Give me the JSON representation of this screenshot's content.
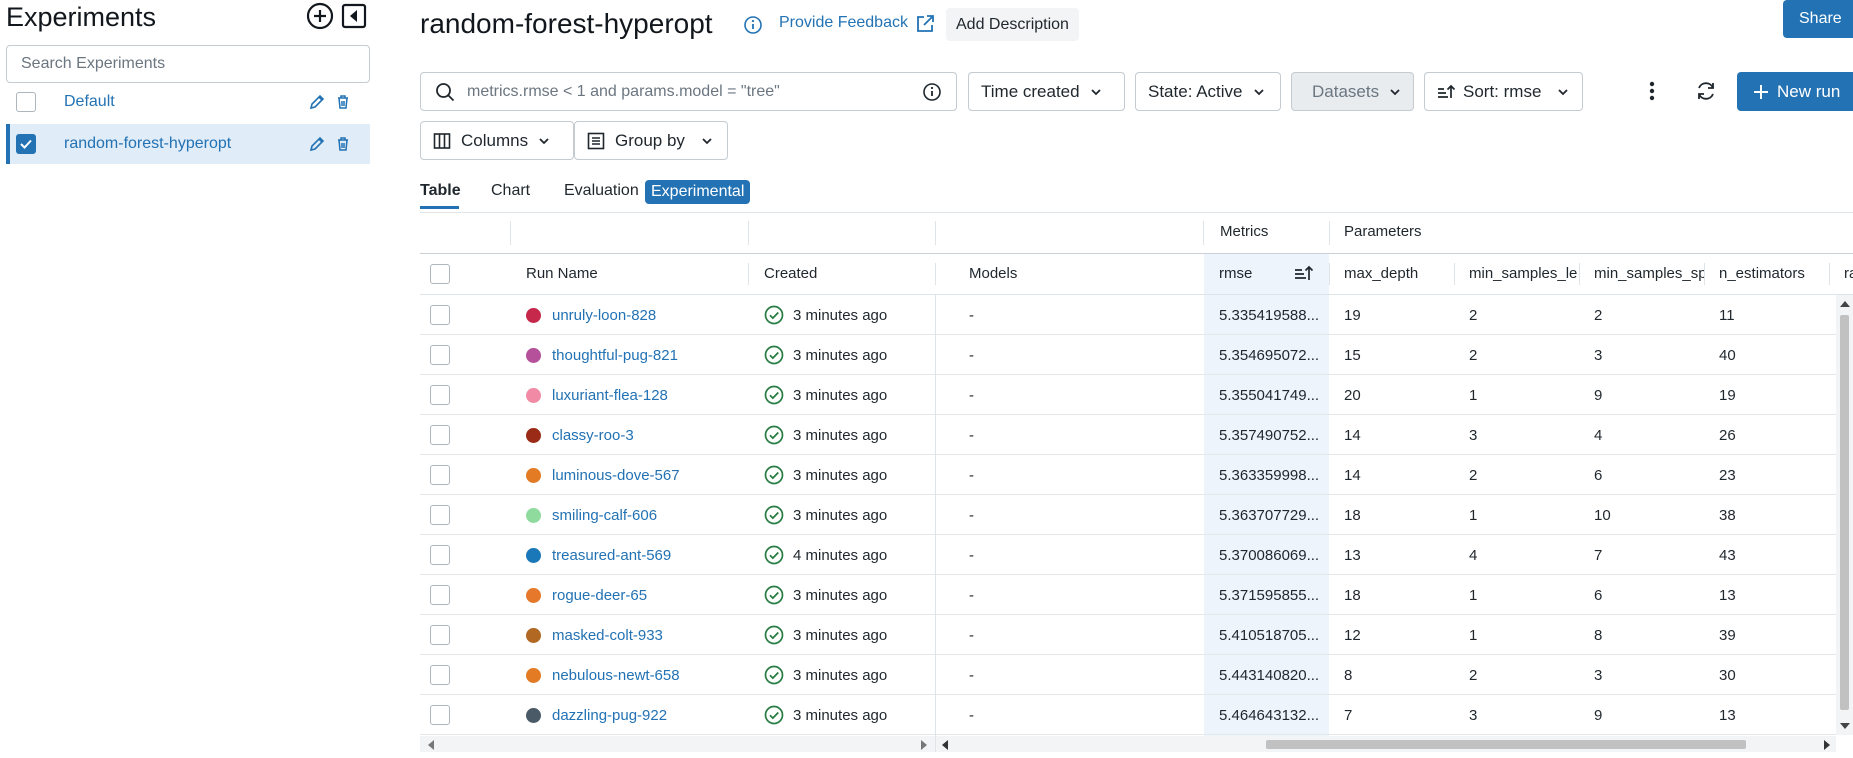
{
  "sidebar": {
    "title": "Experiments",
    "search_placeholder": "Search Experiments",
    "experiments": [
      {
        "name": "Default",
        "checked": false
      },
      {
        "name": "random-forest-hyperopt",
        "checked": true
      }
    ]
  },
  "header": {
    "title": "random-forest-hyperopt",
    "feedback": "Provide Feedback",
    "add_description": "Add Description",
    "share": "Share"
  },
  "toolbar": {
    "search_placeholder": "metrics.rmse < 1 and params.model = \"tree\"",
    "time_created": "Time created",
    "state": "State: Active",
    "datasets": "Datasets",
    "sort": "Sort: rmse",
    "new_run": "New run",
    "columns": "Columns",
    "group_by": "Group by"
  },
  "tabs": {
    "table": "Table",
    "chart": "Chart",
    "evaluation": "Evaluation",
    "experimental": "Experimental"
  },
  "table": {
    "groups": {
      "metrics": "Metrics",
      "parameters": "Parameters"
    },
    "columns": {
      "run_name": "Run Name",
      "created": "Created",
      "models": "Models",
      "rmse": "rmse",
      "max_depth": "max_depth",
      "min_samples_leaf": "min_samples_lea",
      "min_samples_split": "min_samples_sp",
      "n_estimators": "n_estimators",
      "more": "ra"
    },
    "rows": [
      {
        "name": "unruly-loon-828",
        "color": "#c5284b",
        "created": "3 minutes ago",
        "models": "-",
        "rmse": "5.335419588...",
        "max_depth": "19",
        "msl": "2",
        "mss": "2",
        "n_est": "11"
      },
      {
        "name": "thoughtful-pug-821",
        "color": "#b5509a",
        "created": "3 minutes ago",
        "models": "-",
        "rmse": "5.354695072...",
        "max_depth": "15",
        "msl": "2",
        "mss": "3",
        "n_est": "40"
      },
      {
        "name": "luxuriant-flea-128",
        "color": "#f08aa5",
        "created": "3 minutes ago",
        "models": "-",
        "rmse": "5.355041749...",
        "max_depth": "20",
        "msl": "1",
        "mss": "9",
        "n_est": "19"
      },
      {
        "name": "classy-roo-3",
        "color": "#9a2b17",
        "created": "3 minutes ago",
        "models": "-",
        "rmse": "5.357490752...",
        "max_depth": "14",
        "msl": "3",
        "mss": "4",
        "n_est": "26"
      },
      {
        "name": "luminous-dove-567",
        "color": "#e27b24",
        "created": "3 minutes ago",
        "models": "-",
        "rmse": "5.363359998...",
        "max_depth": "14",
        "msl": "2",
        "mss": "6",
        "n_est": "23"
      },
      {
        "name": "smiling-calf-606",
        "color": "#8fdb9e",
        "created": "3 minutes ago",
        "models": "-",
        "rmse": "5.363707729...",
        "max_depth": "18",
        "msl": "1",
        "mss": "10",
        "n_est": "38"
      },
      {
        "name": "treasured-ant-569",
        "color": "#1b78b8",
        "created": "4 minutes ago",
        "models": "-",
        "rmse": "5.370086069...",
        "max_depth": "13",
        "msl": "4",
        "mss": "7",
        "n_est": "43"
      },
      {
        "name": "rogue-deer-65",
        "color": "#e5782a",
        "created": "3 minutes ago",
        "models": "-",
        "rmse": "5.371595855...",
        "max_depth": "18",
        "msl": "1",
        "mss": "6",
        "n_est": "13"
      },
      {
        "name": "masked-colt-933",
        "color": "#b06822",
        "created": "3 minutes ago",
        "models": "-",
        "rmse": "5.410518705...",
        "max_depth": "12",
        "msl": "1",
        "mss": "8",
        "n_est": "39"
      },
      {
        "name": "nebulous-newt-658",
        "color": "#e27b24",
        "created": "3 minutes ago",
        "models": "-",
        "rmse": "5.443140820...",
        "max_depth": "8",
        "msl": "2",
        "mss": "3",
        "n_est": "30"
      },
      {
        "name": "dazzling-pug-922",
        "color": "#4a5a67",
        "created": "3 minutes ago",
        "models": "-",
        "rmse": "5.464643132...",
        "max_depth": "7",
        "msl": "3",
        "mss": "9",
        "n_est": "13"
      }
    ]
  },
  "colors": {
    "accent": "#2272b4",
    "success": "#277c43"
  }
}
